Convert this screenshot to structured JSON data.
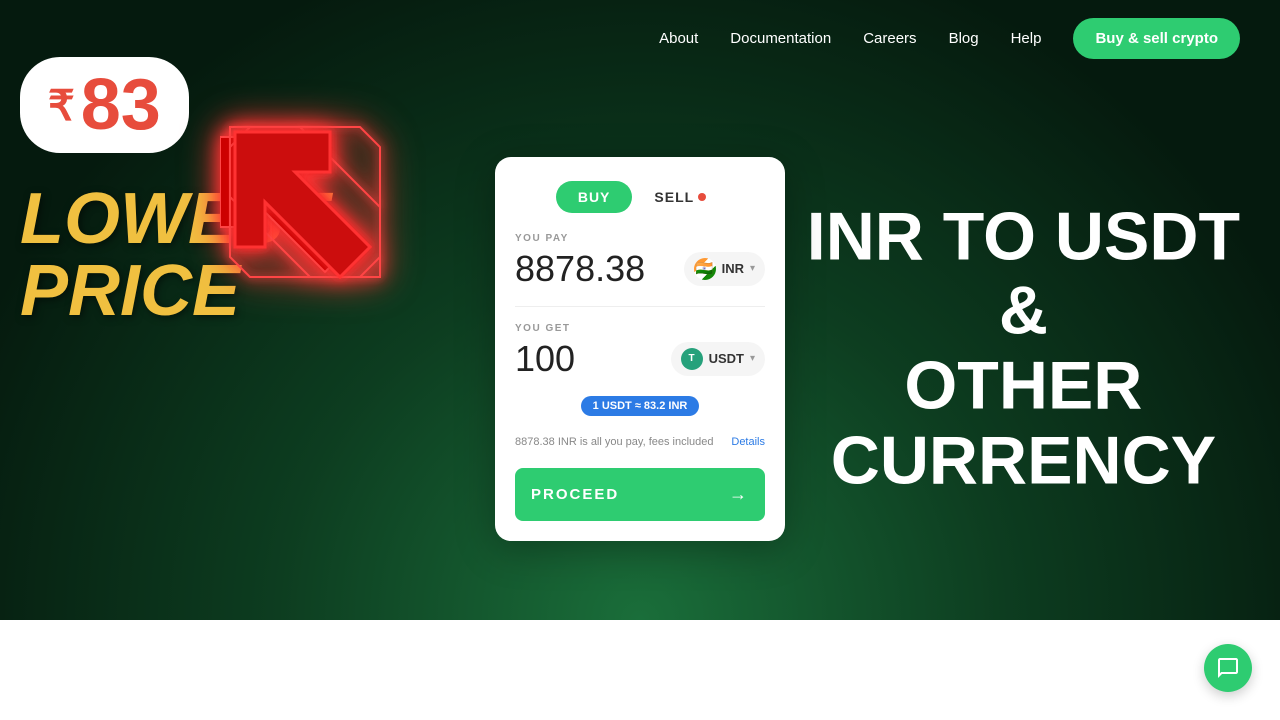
{
  "navbar": {
    "links": [
      {
        "id": "about",
        "label": "About"
      },
      {
        "id": "documentation",
        "label": "Documentation"
      },
      {
        "id": "careers",
        "label": "Careers"
      },
      {
        "id": "blog",
        "label": "Blog"
      },
      {
        "id": "help",
        "label": "Help"
      }
    ],
    "cta_label": "Buy & sell crypto"
  },
  "left_section": {
    "price_symbol": "₹",
    "price_number": "83",
    "line1": "LOWEST",
    "line2": "PRICE"
  },
  "exchange_card": {
    "tab_buy": "BUY",
    "tab_sell": "SELL",
    "you_pay_label": "YOU PAY",
    "you_pay_value": "8878.38",
    "you_pay_currency": "INR",
    "you_get_label": "YOU GET",
    "you_get_value": "100",
    "you_get_currency": "USDT",
    "rate_text": "1 USDT ≈ 83.2 INR",
    "fee_text": "8878.38 INR is all you pay, fees included",
    "details_label": "Details",
    "proceed_label": "PROCEED"
  },
  "right_section": {
    "line1": "INR TO USDT",
    "line2": "&",
    "line3": "OTHER",
    "line4": "CURRENCY"
  },
  "chat": {
    "label": "chat-icon"
  }
}
